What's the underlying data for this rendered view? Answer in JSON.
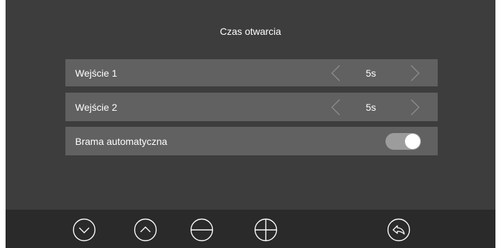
{
  "header": {
    "title": "Czas otwarcia"
  },
  "settings": [
    {
      "label": "Wejście 1",
      "value": "5s"
    },
    {
      "label": "Wejście 2",
      "value": "5s"
    }
  ],
  "auto_gate": {
    "label": "Brama automatyczna",
    "enabled": true
  },
  "toolbar": {
    "icons": [
      "down-icon",
      "up-icon",
      "minus-icon",
      "plus-icon",
      "back-icon"
    ]
  },
  "colors": {
    "background": "#3d3d3d",
    "row": "#616161",
    "bottom_bar": "#2a2a2a",
    "toggle_track": "#9c9c9c",
    "text": "#ffffff"
  }
}
